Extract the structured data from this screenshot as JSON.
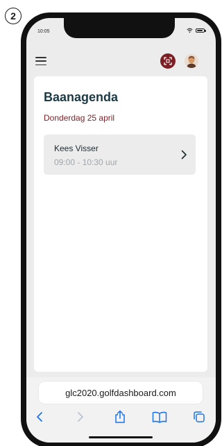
{
  "step": {
    "number": "2"
  },
  "status_bar": {
    "time": "10:05"
  },
  "header": {
    "icons": [
      "menu-icon",
      "scan-icon",
      "avatar"
    ],
    "scan_button_color": "#7b1f24"
  },
  "page": {
    "title": "Baanagenda",
    "date": "Donderdag 25 april",
    "title_color": "#1c3a44",
    "date_color": "#7b1f24"
  },
  "bookings": [
    {
      "name": "Kees Visser",
      "time": "09:00 - 10:30 uur"
    }
  ],
  "browser": {
    "url": "glc2020.golfdashboard.com",
    "toolbar_icons": [
      "back-icon",
      "forward-icon",
      "share-icon",
      "bookmarks-icon",
      "tabs-icon"
    ],
    "accent_color": "#1a73e8"
  }
}
